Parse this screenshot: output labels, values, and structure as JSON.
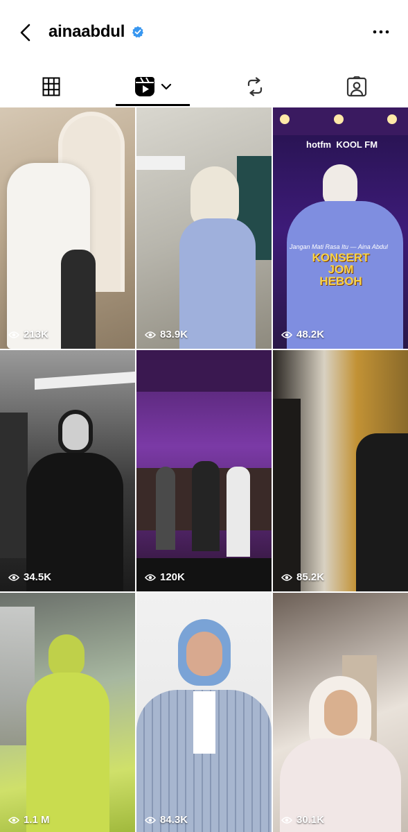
{
  "header": {
    "username": "ainaabdul",
    "verified": true,
    "verified_color": "#3897f0"
  },
  "tabs": [
    {
      "name": "grid",
      "icon": "grid-icon",
      "active": false
    },
    {
      "name": "reels",
      "icon": "reels-icon",
      "active": true
    },
    {
      "name": "reposts",
      "icon": "repost-icon",
      "active": false
    },
    {
      "name": "tagged",
      "icon": "tagged-icon",
      "active": false
    }
  ],
  "posts": [
    {
      "views": "213K"
    },
    {
      "views": "83.9K"
    },
    {
      "views": "48.2K",
      "overlay": {
        "brands": "hotfm  KOOL FM",
        "subtitle": "Jangan Mati Rasa Itu — Aina Abdul",
        "title": "KONSERT JOM HEBOH"
      }
    },
    {
      "views": "34.5K"
    },
    {
      "views": "120K"
    },
    {
      "views": "85.2K"
    },
    {
      "views": "1.1 M"
    },
    {
      "views": "84.3K"
    },
    {
      "views": "30.1K"
    }
  ]
}
